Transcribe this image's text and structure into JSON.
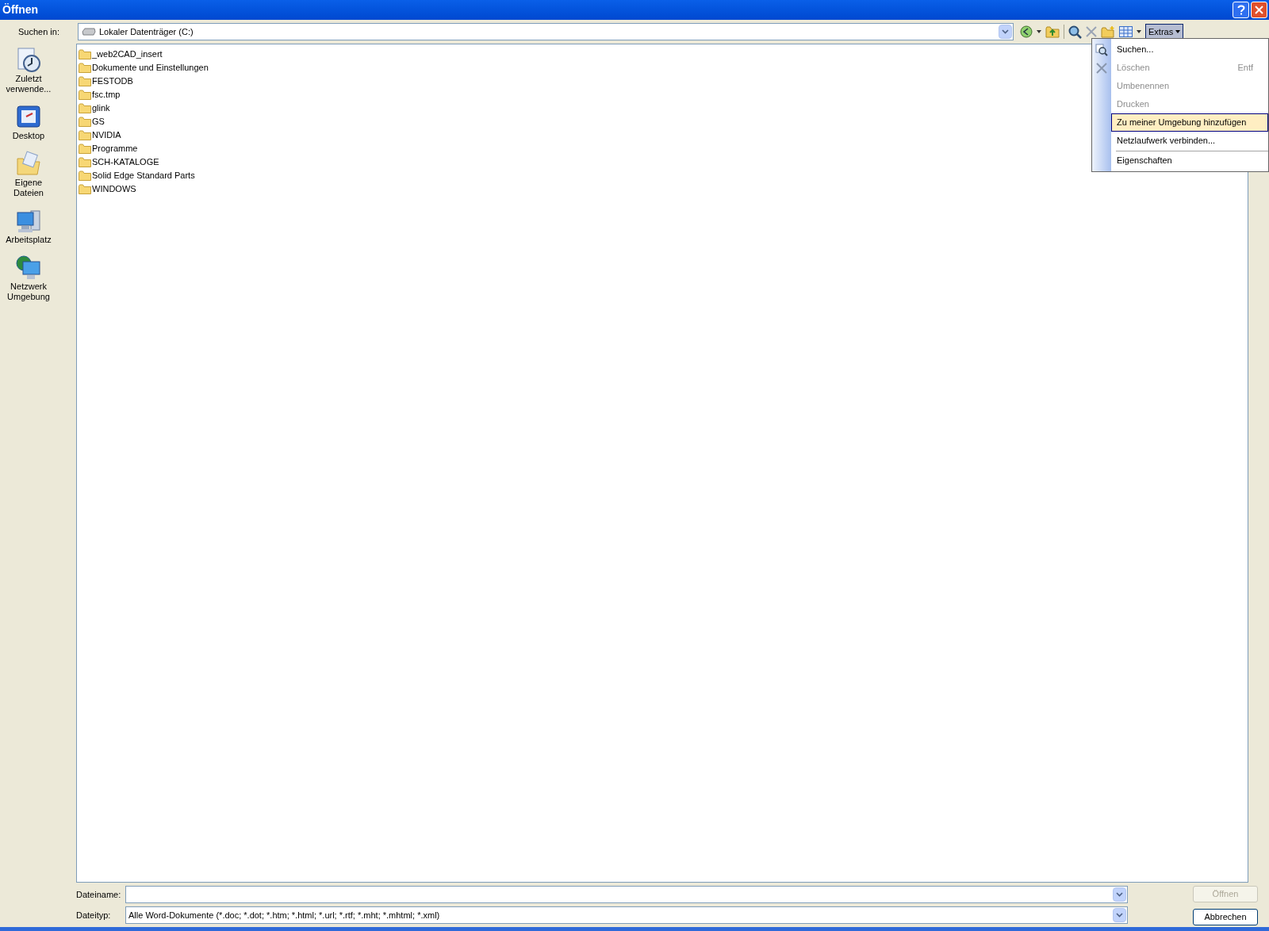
{
  "window": {
    "title": "Öffnen"
  },
  "look_in": {
    "label": "Suchen in:",
    "value": "Lokaler Datenträger (C:)"
  },
  "toolbar": {
    "extras": "Extras"
  },
  "places": [
    {
      "label": "Zuletzt verwende...",
      "kind": "recent"
    },
    {
      "label": "Desktop",
      "kind": "desktop"
    },
    {
      "label": "Eigene Dateien",
      "kind": "documents"
    },
    {
      "label": "Arbeitsplatz",
      "kind": "computer"
    },
    {
      "label": "Netzwerk Umgebung",
      "kind": "network"
    }
  ],
  "files": [
    "_web2CAD_insert",
    "Dokumente und Einstellungen",
    "FESTODB",
    "fsc.tmp",
    "glink",
    "GS",
    "NVIDIA",
    "Programme",
    "SCH-KATALOGE",
    "Solid Edge Standard Parts",
    "WINDOWS"
  ],
  "menu": [
    {
      "label": "Suchen...",
      "kind": "search",
      "disabled": false,
      "selected": false
    },
    {
      "label": "Löschen",
      "shortcut": "Entf",
      "kind": "delete",
      "disabled": true,
      "selected": false
    },
    {
      "label": "Umbenennen",
      "disabled": true,
      "selected": false
    },
    {
      "label": "Drucken",
      "disabled": true,
      "selected": false
    },
    {
      "label": "Zu meiner Umgebung hinzufügen",
      "disabled": false,
      "selected": true
    },
    {
      "label": "Netzlaufwerk verbinden...",
      "disabled": false,
      "selected": false,
      "separator_after": true
    },
    {
      "label": "Eigenschaften",
      "disabled": false,
      "selected": false
    }
  ],
  "filename": {
    "label": "Dateiname:"
  },
  "filetype": {
    "label": "Dateityp:",
    "value": "Alle Word-Dokumente (*.doc; *.dot; *.htm; *.html; *.url; *.rtf; *.mht; *.mhtml; *.xml)"
  },
  "buttons": [
    {
      "label": "Öffnen",
      "disabled": true
    },
    {
      "label": "Abbrechen",
      "disabled": false
    }
  ]
}
